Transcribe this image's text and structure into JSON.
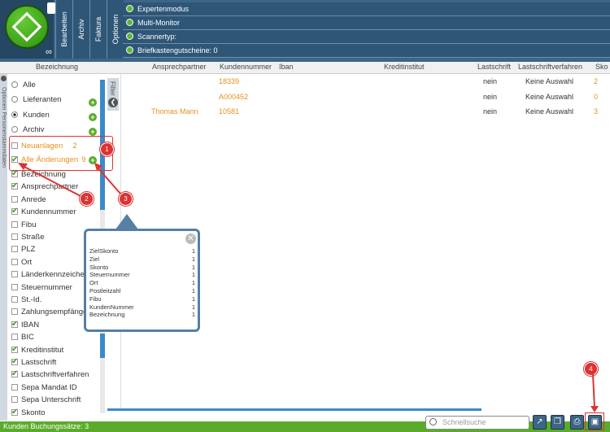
{
  "header": {
    "vtabs": [
      "Bearbeiten",
      "Archiv",
      "Faktura",
      "Optionen"
    ],
    "rows": [
      "Expertenmodus",
      "Multi-Monitor",
      "Scannertyp:",
      "Briefkastengutscheine: 0"
    ]
  },
  "columns": [
    "Bezeichnung",
    "Ansprechpartner",
    "Kundennummer",
    "Iban",
    "Kreditinstitut",
    "Lastschrift",
    "Lastschriftverfahren",
    "Sko"
  ],
  "side_strip": "Optionen  Personenstammdaten",
  "filter_tab": "Filter",
  "filter": {
    "groups": [
      {
        "label": "Alle",
        "selected": false,
        "plus": false
      },
      {
        "label": "Lieferanten",
        "selected": false,
        "plus": true
      },
      {
        "label": "Kunden",
        "selected": true,
        "plus": true
      },
      {
        "label": "Archiv",
        "selected": false,
        "plus": true
      }
    ],
    "neuanlagen": {
      "label": "Neuanlagen",
      "count": "2"
    },
    "aenderungen": {
      "label": "Alle Änderungen",
      "count": "9"
    },
    "fields": [
      {
        "label": "Bezeichnung",
        "checked": true
      },
      {
        "label": "Ansprechpartner",
        "checked": true
      },
      {
        "label": "Anrede",
        "checked": false
      },
      {
        "label": "Kundennummer",
        "checked": true
      },
      {
        "label": "Fibu",
        "checked": false
      },
      {
        "label": "Straße",
        "checked": false
      },
      {
        "label": "PLZ",
        "checked": false
      },
      {
        "label": "Ort",
        "checked": false
      },
      {
        "label": "Länderkennzeichen",
        "checked": false
      },
      {
        "label": "Steuernummer",
        "checked": false
      },
      {
        "label": "St.-Id.",
        "checked": false
      },
      {
        "label": "Zahlungsempfänger",
        "checked": false
      },
      {
        "label": "IBAN",
        "checked": true
      },
      {
        "label": "BIC",
        "checked": false
      },
      {
        "label": "Kreditinstitut",
        "checked": true
      },
      {
        "label": "Lastschrift",
        "checked": true
      },
      {
        "label": "Lastschriftverfahren",
        "checked": true
      },
      {
        "label": "Sepa Mandat ID",
        "checked": false
      },
      {
        "label": "Sepa Unterschrift",
        "checked": false
      },
      {
        "label": "Skonto",
        "checked": true
      }
    ]
  },
  "rows": [
    {
      "ansprechpartner": "",
      "kundennummer": "18339",
      "lastschrift": "nein",
      "verfahren": "Keine Auswahl",
      "skonto": "2"
    },
    {
      "ansprechpartner": "",
      "kundennummer": "A000452",
      "lastschrift": "nein",
      "verfahren": "Keine Auswahl",
      "skonto": "0"
    },
    {
      "ansprechpartner": "Thomas Mann",
      "kundennummer": "10581",
      "lastschrift": "nein",
      "verfahren": "Keine Auswahl",
      "skonto": "3"
    }
  ],
  "popup": {
    "rows": [
      {
        "label": "ZielSkonto",
        "value": "1"
      },
      {
        "label": "Ziel",
        "value": "1"
      },
      {
        "label": "Skonto",
        "value": "1"
      },
      {
        "label": "Steuernummer",
        "value": "1"
      },
      {
        "label": "Ort",
        "value": "1"
      },
      {
        "label": "Postleitzahl",
        "value": "1"
      },
      {
        "label": "Fibu",
        "value": "1"
      },
      {
        "label": "KundenNummer",
        "value": "1"
      },
      {
        "label": "Bezeichnung",
        "value": "1"
      }
    ],
    "close": "✕"
  },
  "badges": [
    "1",
    "2",
    "3",
    "4"
  ],
  "status": "Kunden Buchungssätze: 3",
  "search": {
    "placeholder": "Schnellsuche"
  },
  "colors": {
    "header": "#3d6587",
    "accent": "#5aab2a",
    "orange": "#e8901a",
    "annotation": "#dd3333"
  }
}
